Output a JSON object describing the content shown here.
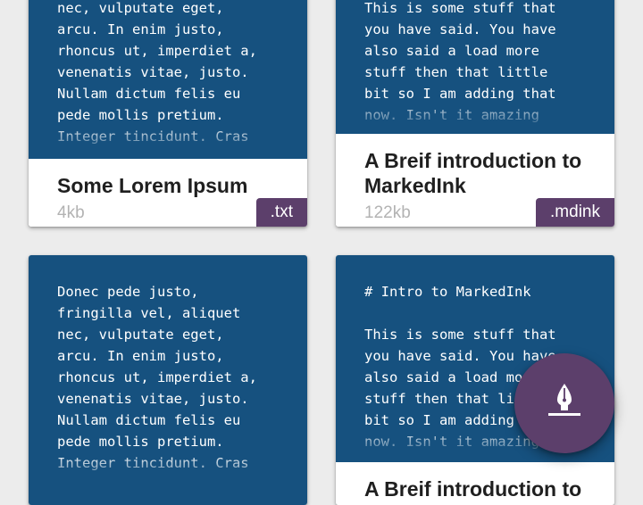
{
  "files": [
    {
      "preview": "nec, vulputate eget,\narcu. In enim justo,\nrhoncus ut, imperdiet a,\nvenenatis vitae, justo.\nNullam dictum felis eu\npede mollis pretium.\nInteger tincidunt. Cras",
      "title": "Some Lorem Ipsum",
      "size": "4kb",
      "extension": ".txt"
    },
    {
      "preview": "This is some stuff that\nyou have said. You have\nalso said a load more\nstuff then that little\nbit so I am adding that\nnow. Isn't it amazing",
      "title": "A Breif introduction to MarkedInk",
      "size": "122kb",
      "extension": ".mdink"
    },
    {
      "preview": "Donec pede justo,\nfringilla vel, aliquet\nnec, vulputate eget,\narcu. In enim justo,\nrhoncus ut, imperdiet a,\nvenenatis vitae, justo.\nNullam dictum felis eu\npede mollis pretium.\nInteger tincidunt. Cras",
      "title": "",
      "size": "",
      "extension": ""
    },
    {
      "preview": "# Intro to MarkedInk\n\nThis is some stuff that\nyou have said. You have\nalso said a load more\nstuff then that little\nbit so I am adding that\nnow. Isn't it amazing",
      "title": "A Breif introduction to MarkedInk",
      "size": "",
      "extension": ""
    }
  ],
  "fab": {
    "icon": "pen-nib-icon"
  },
  "colors": {
    "preview_background": "#16517f",
    "accent": "#5c3f6b",
    "page_background": "#ececec"
  }
}
